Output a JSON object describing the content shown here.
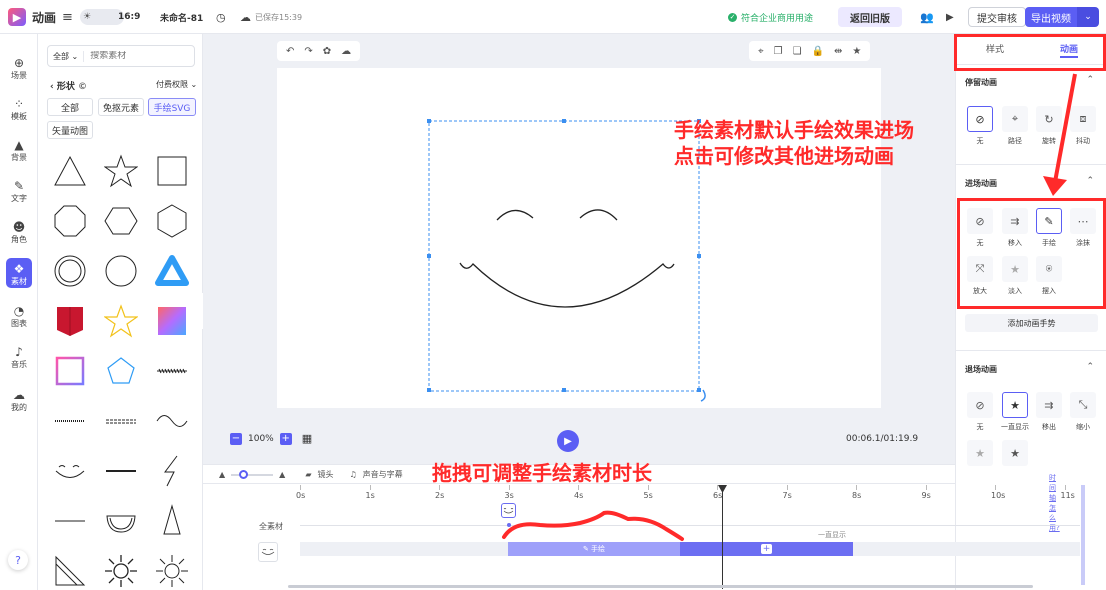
{
  "topbar": {
    "app_name": "动画",
    "ratio": "16:9",
    "doc_name": "未命名-81",
    "saved": "已保存15:39",
    "commercial": "符合企业商用用途",
    "back_old": "返回旧版",
    "submit": "提交审核",
    "export": "导出视频"
  },
  "leftnav": [
    {
      "label": "场景",
      "icon": "scene-icon"
    },
    {
      "label": "模板",
      "icon": "template-icon"
    },
    {
      "label": "背景",
      "icon": "background-icon"
    },
    {
      "label": "文字",
      "icon": "text-icon"
    },
    {
      "label": "角色",
      "icon": "character-icon"
    },
    {
      "label": "素材",
      "icon": "material-icon"
    },
    {
      "label": "图表",
      "icon": "chart-icon"
    },
    {
      "label": "音乐",
      "icon": "music-icon"
    },
    {
      "label": "我的",
      "icon": "cloud-icon"
    }
  ],
  "help": "?",
  "panel": {
    "scope": "全部",
    "search_placeholder": "搜索素材",
    "category": "形状",
    "pay": "付费权限",
    "chips": [
      "全部",
      "免抠元素",
      "手绘SVG",
      "矢量动图"
    ]
  },
  "canvas": {
    "zoom": "100%",
    "time": "00:06.1/01:19.9"
  },
  "rightpanel": {
    "tab_style": "样式",
    "tab_anim": "动画",
    "stay_title": "停留动画",
    "stay_items": [
      "无",
      "路径",
      "旋转",
      "抖动"
    ],
    "enter_title": "进场动画",
    "enter_items": [
      "无",
      "移入",
      "手绘",
      "涂抹",
      "放大",
      "淡入",
      "摆入"
    ],
    "add_gesture": "添加动画手势",
    "exit_title": "退场动画",
    "exit_items": [
      "无",
      "一直显示",
      "移出",
      "缩小"
    ]
  },
  "timeline": {
    "lens": "镜头",
    "audio": "声音与字幕",
    "help_link": "时间轴怎么用?",
    "ticks": [
      "0s",
      "1s",
      "2s",
      "3s",
      "4s",
      "5s",
      "6s",
      "7s",
      "8s",
      "9s",
      "10s",
      "11s"
    ],
    "track_label": "全素材",
    "bar_label": "手绘",
    "always_label": "一直显示"
  },
  "annotations": {
    "right_line1": "手绘素材默认手绘效果进场",
    "right_line2": "点击可修改其他进场动画",
    "bottom": "拖拽可调整手绘素材时长"
  },
  "colors": {
    "accent": "#5b5ef4",
    "red": "#ff2a2a",
    "green": "#29b06a"
  }
}
